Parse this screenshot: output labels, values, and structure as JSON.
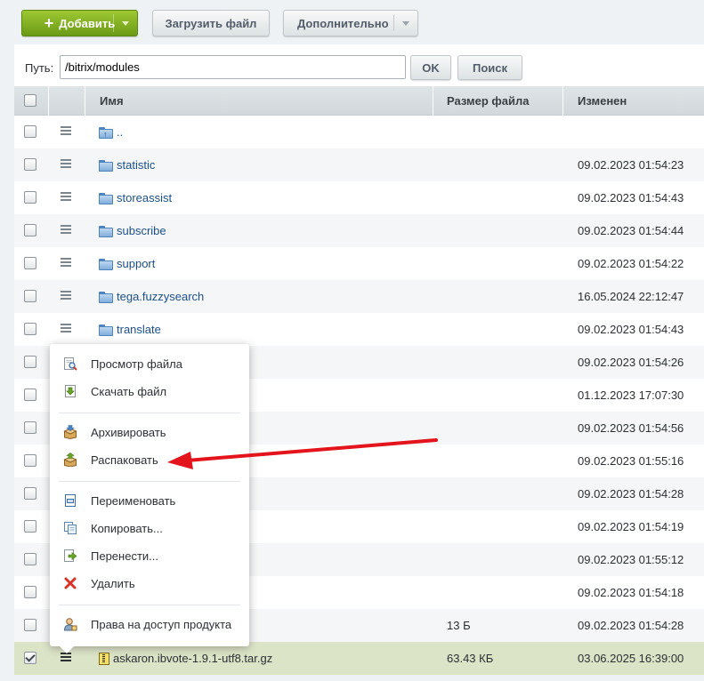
{
  "toolbar": {
    "add_label": "Добавить",
    "upload_label": "Загрузить файл",
    "more_label": "Дополнительно"
  },
  "path": {
    "label": "Путь:",
    "value": "/bitrix/modules",
    "ok_label": "OK",
    "search_label": "Поиск"
  },
  "grid": {
    "headers": {
      "name": "Имя",
      "size": "Размер файла",
      "modified": "Изменен"
    },
    "rows": [
      {
        "name": "..",
        "size": "",
        "date": "",
        "type": "up"
      },
      {
        "name": "statistic",
        "size": "",
        "date": "09.02.2023 01:54:23",
        "type": "folder"
      },
      {
        "name": "storeassist",
        "size": "",
        "date": "09.02.2023 01:54:43",
        "type": "folder"
      },
      {
        "name": "subscribe",
        "size": "",
        "date": "09.02.2023 01:54:44",
        "type": "folder"
      },
      {
        "name": "support",
        "size": "",
        "date": "09.02.2023 01:54:22",
        "type": "folder"
      },
      {
        "name": "tega.fuzzysearch",
        "size": "",
        "date": "16.05.2024 22:12:47",
        "type": "folder"
      },
      {
        "name": "translate",
        "size": "",
        "date": "09.02.2023 01:54:43",
        "type": "folder"
      },
      {
        "name": "",
        "size": "",
        "date": "09.02.2023 01:54:26",
        "type": "hidden"
      },
      {
        "name": "",
        "size": "",
        "date": "01.12.2023 17:07:30",
        "type": "hidden"
      },
      {
        "name": "",
        "size": "",
        "date": "09.02.2023 01:54:56",
        "type": "hidden"
      },
      {
        "name": "",
        "size": "",
        "date": "09.02.2023 01:55:16",
        "type": "hidden"
      },
      {
        "name": "",
        "size": "",
        "date": "09.02.2023 01:54:28",
        "type": "hidden"
      },
      {
        "name": "",
        "size": "",
        "date": "09.02.2023 01:54:19",
        "type": "hidden"
      },
      {
        "name": "",
        "size": "",
        "date": "09.02.2023 01:55:12",
        "type": "hidden"
      },
      {
        "name": "",
        "size": "",
        "date": "09.02.2023 01:54:18",
        "type": "hidden"
      },
      {
        "name": "",
        "size": "13 Б",
        "date": "09.02.2023 01:54:28",
        "type": "hidden"
      },
      {
        "name": "askaron.ibvote-1.9.1-utf8.tar.gz",
        "size": "63.43 КБ",
        "date": "03.06.2025 16:39:00",
        "type": "archive",
        "selected": true
      }
    ]
  },
  "context_menu": {
    "items": [
      {
        "label": "Просмотр файла",
        "icon": "view-file-icon"
      },
      {
        "label": "Скачать файл",
        "icon": "download-icon"
      },
      {
        "label": "Архивировать",
        "icon": "archive-icon"
      },
      {
        "label": "Распаковать",
        "icon": "unpack-icon"
      },
      {
        "label": "Переименовать",
        "icon": "rename-icon"
      },
      {
        "label": "Копировать...",
        "icon": "copy-icon"
      },
      {
        "label": "Перенести...",
        "icon": "move-icon"
      },
      {
        "label": "Удалить",
        "icon": "delete-icon"
      },
      {
        "label": "Права на доступ продукта",
        "icon": "access-rights-icon"
      }
    ]
  },
  "colors": {
    "accent_green": "#7fae1f",
    "link_blue": "#1d4f8a",
    "annotation_red": "#e3141b",
    "selected_row": "#dce4c8"
  }
}
